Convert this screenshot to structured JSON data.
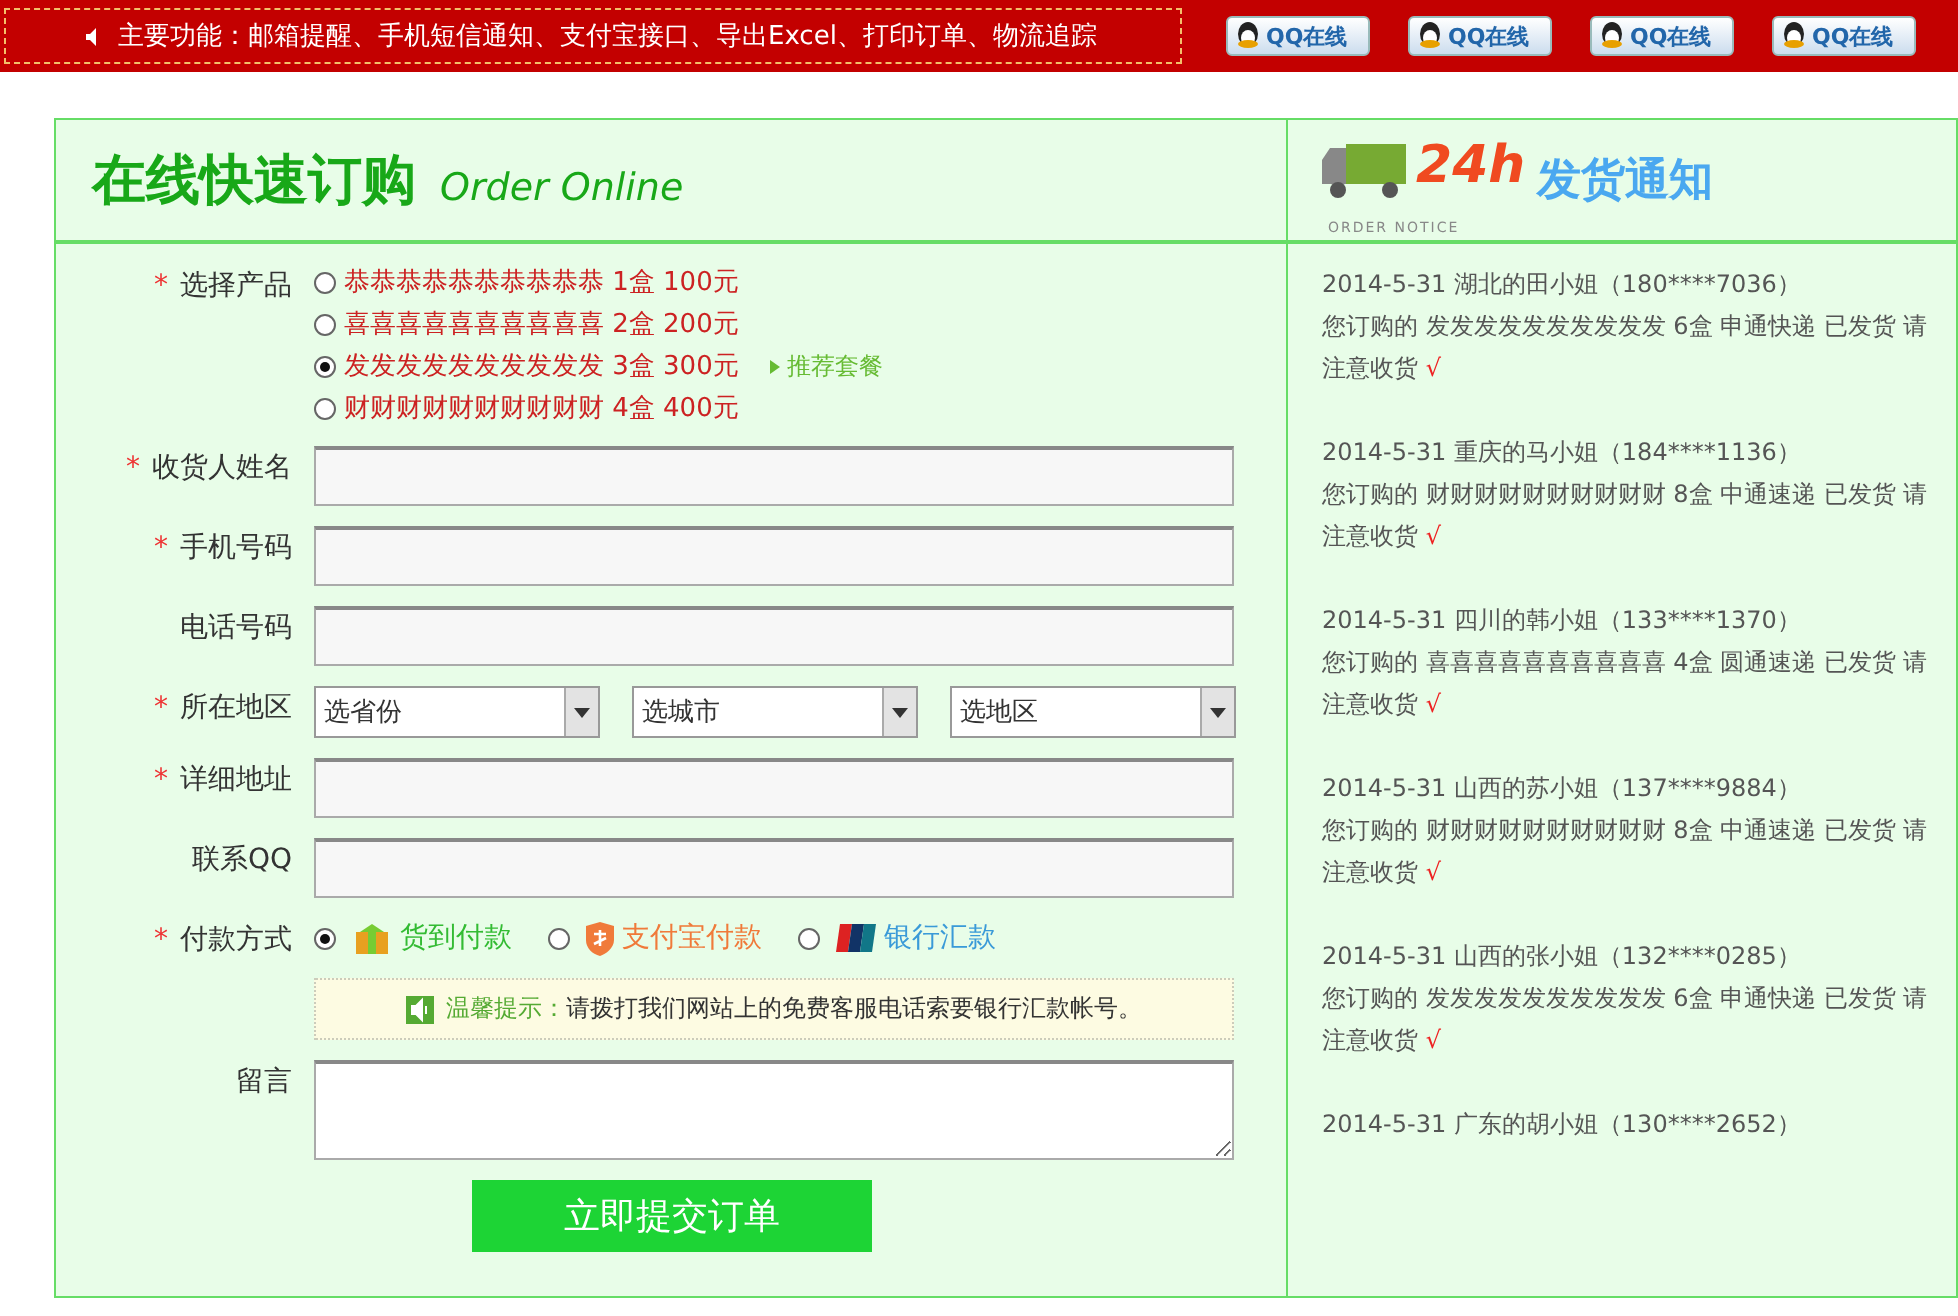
{
  "top_bar": {
    "features": "主要功能：邮箱提醒、手机短信通知、支付宝接口、导出Excel、打印订单、物流追踪",
    "qq_buttons": [
      "QQ在线",
      "QQ在线",
      "QQ在线",
      "QQ在线"
    ]
  },
  "order": {
    "title": "在线快速订购",
    "subtitle": "Order Online",
    "product": {
      "label": "选择产品",
      "required_mark": "*",
      "options": [
        {
          "name": "恭恭恭恭恭恭恭恭恭恭",
          "amount": "1盒 100元",
          "selected": false
        },
        {
          "name": "喜喜喜喜喜喜喜喜喜喜",
          "amount": "2盒 200元",
          "selected": false
        },
        {
          "name": "发发发发发发发发发发",
          "amount": "3盒 300元",
          "selected": true,
          "tag": "推荐套餐"
        },
        {
          "name": "财财财财财财财财财财",
          "amount": "4盒 400元",
          "selected": false
        }
      ]
    },
    "fields": [
      {
        "kind": "text",
        "label": "收货人姓名",
        "required_mark": "*"
      },
      {
        "kind": "text",
        "label": "手机号码",
        "required_mark": "*"
      },
      {
        "kind": "text",
        "label": "电话号码"
      },
      {
        "kind": "selects",
        "label": "所在地区",
        "required_mark": "*",
        "selects": [
          "选省份",
          "选城市",
          "选地区"
        ]
      },
      {
        "kind": "text",
        "label": "详细地址",
        "required_mark": "*"
      },
      {
        "kind": "text",
        "label": "联系QQ"
      }
    ],
    "payment": {
      "label": "付款方式",
      "required_mark": "*",
      "options": [
        {
          "kind": "cod",
          "text": "货到付款",
          "selected": true
        },
        {
          "kind": "alipay",
          "text": "支付宝付款",
          "selected": false
        },
        {
          "kind": "bank",
          "text": "银行汇款",
          "selected": false
        }
      ],
      "tip_title": "温馨提示：",
      "tip": "请拨打我们网站上的免费客服电话索要银行汇款帐号。"
    },
    "message": {
      "label": "留言"
    },
    "submit": "立即提交订单"
  },
  "notices": {
    "logo_24": "24h",
    "logo_sub": "ORDER NOTICE",
    "title": "发货通知",
    "items": [
      {
        "header": "2014-5-31 湖北的田小姐（180****7036）",
        "body": "您订购的 发发发发发发发发发发 6盒 申通快递 已发货 请注意收货",
        "mark": "√"
      },
      {
        "header": "2014-5-31 重庆的马小姐（184****1136）",
        "body": "您订购的 财财财财财财财财财财 8盒 中通速递 已发货 请注意收货",
        "mark": "√"
      },
      {
        "header": "2014-5-31 四川的韩小姐（133****1370）",
        "body": "您订购的 喜喜喜喜喜喜喜喜喜喜 4盒 圆通速递 已发货 请注意收货",
        "mark": "√"
      },
      {
        "header": "2014-5-31 山西的苏小姐（137****9884）",
        "body": "您订购的 财财财财财财财财财财 8盒 中通速递 已发货 请注意收货",
        "mark": "√"
      },
      {
        "header": "2014-5-31 山西的张小姐（132****0285）",
        "body": "您订购的 发发发发发发发发发发 6盒 申通快递 已发货 请注意收货",
        "mark": "√"
      },
      {
        "header": "2014-5-31 广东的胡小姐（130****2652）"
      }
    ]
  }
}
